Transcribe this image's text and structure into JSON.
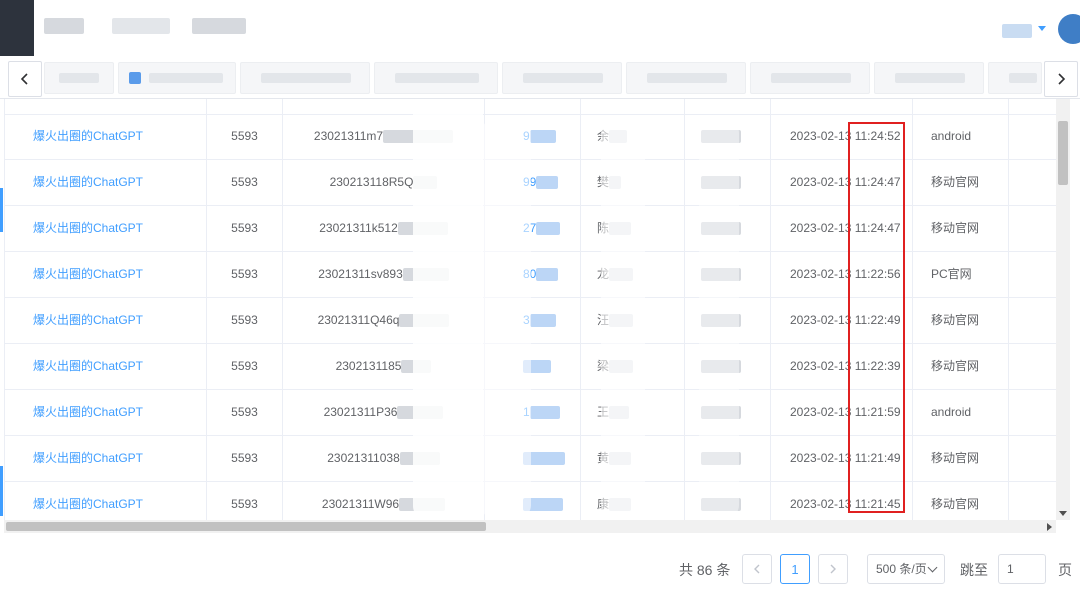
{
  "table": {
    "rows": [
      {
        "name": "爆火出圈的ChatGPT",
        "num": "5593",
        "order": "23021311m7",
        "amt": "9",
        "user": "余",
        "time": "2023-02-13 11:24:52",
        "source": "android"
      },
      {
        "name": "爆火出圈的ChatGPT",
        "num": "5593",
        "order": "230213118R5Q",
        "amt": "99",
        "user": "樊",
        "time": "2023-02-13 11:24:47",
        "source": "移动官网"
      },
      {
        "name": "爆火出圈的ChatGPT",
        "num": "5593",
        "order": "23021311k512",
        "amt": "27",
        "user": "陈",
        "time": "2023-02-13 11:24:47",
        "source": "移动官网"
      },
      {
        "name": "爆火出圈的ChatGPT",
        "num": "5593",
        "order": "23021311sv893",
        "amt": "80",
        "user": "龙",
        "time": "2023-02-13 11:22:56",
        "source": "PC官网"
      },
      {
        "name": "爆火出圈的ChatGPT",
        "num": "5593",
        "order": "23021311Q46q",
        "amt": "3",
        "user": "汪",
        "time": "2023-02-13 11:22:49",
        "source": "移动官网"
      },
      {
        "name": "爆火出圈的ChatGPT",
        "num": "5593",
        "order": "2302131185",
        "amt": "",
        "user": "梁",
        "time": "2023-02-13 11:22:39",
        "source": "移动官网"
      },
      {
        "name": "爆火出圈的ChatGPT",
        "num": "5593",
        "order": "23021311P36",
        "amt": "1",
        "user": "王",
        "time": "2023-02-13 11:21:59",
        "source": "android"
      },
      {
        "name": "爆火出圈的ChatGPT",
        "num": "5593",
        "order": "23021311038",
        "amt": "",
        "user": "黄",
        "time": "2023-02-13 11:21:49",
        "source": "移动官网"
      },
      {
        "name": "爆火出圈的ChatGPT",
        "num": "5593",
        "order": "23021311W96",
        "amt": "",
        "user": "康",
        "time": "2023-02-13 11:21:45",
        "source": "移动官网"
      }
    ]
  },
  "pagination": {
    "total_text": "共 86 条",
    "current_page": "1",
    "page_size": "500 条/页",
    "goto_label": "跳至",
    "goto_value": "1",
    "page_unit": "页"
  },
  "colors": {
    "link": "#409eff",
    "highlight_border": "#e02020"
  },
  "icons": [
    "chevron-left-icon",
    "chevron-right-icon",
    "caret-down-icon",
    "avatar-icon"
  ]
}
